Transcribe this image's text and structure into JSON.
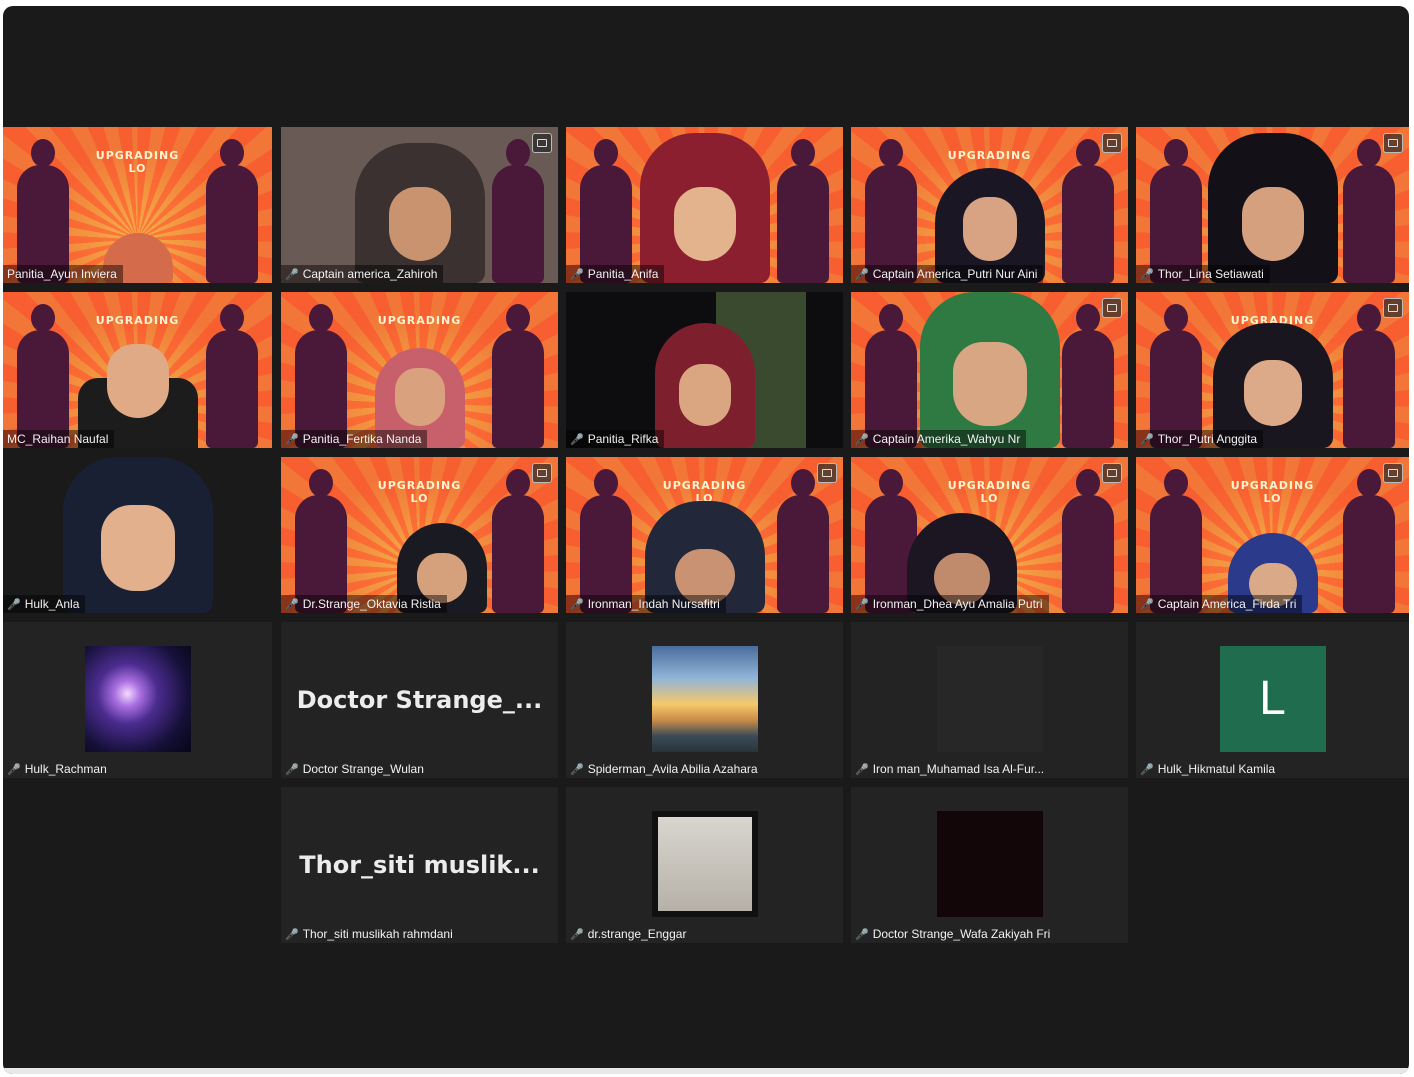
{
  "meeting": {
    "banner_title_1": "UPGRADING",
    "banner_title_2": "LO",
    "participants_row1": [
      "Panitia_Ayun Inviera",
      "Captain america_Zahiroh",
      "Panitia_Anifa",
      "Captain America_Putri Nur Aini",
      "Thor_Lina Setiawati"
    ],
    "participants_row2": [
      "MC_Raihan Naufal",
      "Panitia_Fertika Nanda",
      "Panitia_Rifka",
      "Captain Amerika_Wahyu Nr",
      "Thor_Putri Anggita"
    ],
    "participants_row3": [
      "Hulk_Anla",
      "Dr.Strange_Oktavia Ristia",
      "Ironman_Indah Nursafitri",
      "Ironman_Dhea Ayu Amalia Putri",
      "Captain America_Firda Tri"
    ],
    "participants_row4": [
      "Hulk_Rachman",
      "Doctor Strange_Wulan",
      "Spiderman_Avila Abilia Azahara",
      "Iron man_Muhamad Isa Al-Fur...",
      "Hulk_Hikmatul Kamila"
    ],
    "row4_center_label": "Doctor  Strange_...",
    "row4_letter": "L",
    "participants_row5": [
      "Thor_siti muslikah rahmdani",
      "dr.strange_Enggar",
      "Doctor Strange_Wafa Zakiyah Fri"
    ],
    "row5_center_label": "Thor_siti  muslik..."
  },
  "icons": {
    "mic_muted": "mic-muted-icon",
    "camera": "camera-icon"
  },
  "colors": {
    "background": "#1a1a1a",
    "tile": "#232323",
    "banner_orange": "#ff7a3a",
    "silhouette": "#4a1838",
    "muted_mic": "#e0413b",
    "letter_avatar": "#1f6d4e"
  }
}
